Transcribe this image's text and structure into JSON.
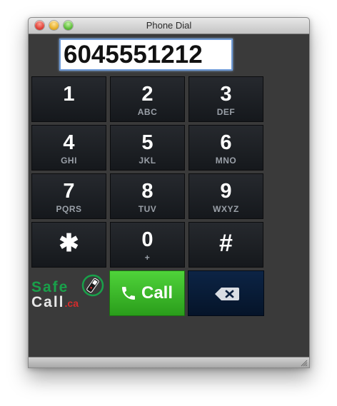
{
  "window": {
    "title": "Phone Dial"
  },
  "display": {
    "value": "6045551212"
  },
  "keypad": {
    "keys": [
      {
        "digit": "1",
        "letters": ""
      },
      {
        "digit": "2",
        "letters": "ABC"
      },
      {
        "digit": "3",
        "letters": "DEF"
      },
      {
        "digit": "4",
        "letters": "GHI"
      },
      {
        "digit": "5",
        "letters": "JKL"
      },
      {
        "digit": "6",
        "letters": "MNO"
      },
      {
        "digit": "7",
        "letters": "PQRS"
      },
      {
        "digit": "8",
        "letters": "TUV"
      },
      {
        "digit": "9",
        "letters": "WXYZ"
      },
      {
        "digit": "✱",
        "letters": ""
      },
      {
        "digit": "0",
        "letters": "+"
      },
      {
        "digit": "#",
        "letters": ""
      }
    ]
  },
  "logo": {
    "line1": "Safe",
    "line2": "Call",
    "suffix": ".ca"
  },
  "actions": {
    "call_label": "Call",
    "call_icon": "phone-icon",
    "delete_icon": "backspace-icon"
  },
  "colors": {
    "call_green": "#2fae22",
    "delete_navy": "#0a1f3d",
    "display_border": "#6e9ad6",
    "logo_green": "#19a14a",
    "logo_red": "#d62b2b"
  }
}
